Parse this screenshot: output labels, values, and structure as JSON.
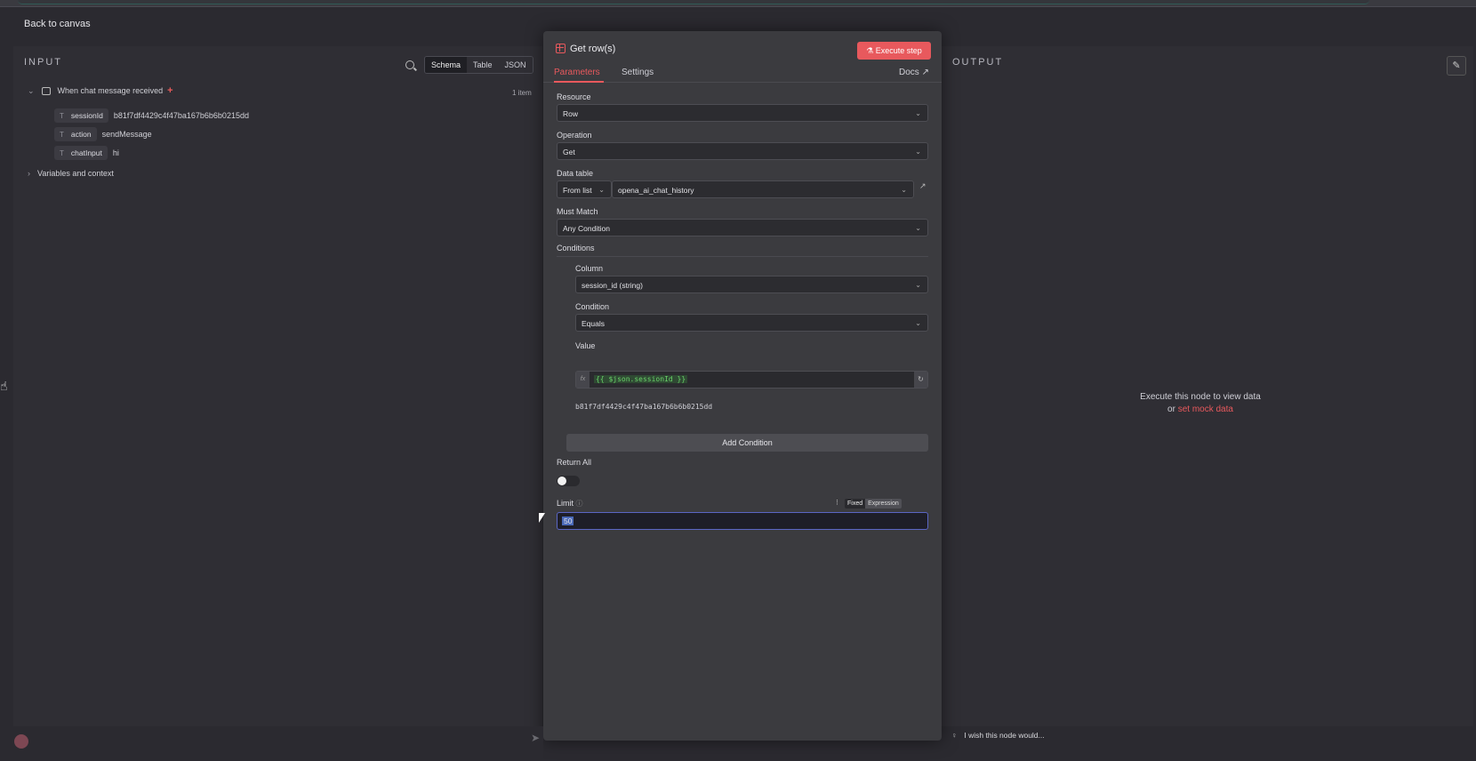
{
  "nav": {
    "back_label": "Back to canvas"
  },
  "input": {
    "title": "INPUT",
    "tabs": [
      "Schema",
      "Table",
      "JSON"
    ],
    "active_tab": "Schema",
    "item_count": "1 item",
    "trigger": "When chat message received",
    "fields": [
      {
        "type": "T",
        "key": "sessionId",
        "value": "b81f7df4429c4f47ba167b6b6b0215dd"
      },
      {
        "type": "T",
        "key": "action",
        "value": "sendMessage"
      },
      {
        "type": "T",
        "key": "chatInput",
        "value": "hi"
      }
    ],
    "variables_label": "Variables and context"
  },
  "node": {
    "title": "Get row(s)",
    "execute_label": "Execute step",
    "tabs": [
      "Parameters",
      "Settings"
    ],
    "docs_label": "Docs",
    "resource": {
      "label": "Resource",
      "value": "Row"
    },
    "operation": {
      "label": "Operation",
      "value": "Get"
    },
    "data_table": {
      "label": "Data table",
      "mode": "From list",
      "value": "opena_ai_chat_history"
    },
    "must_match": {
      "label": "Must Match",
      "value": "Any Condition"
    },
    "conditions_label": "Conditions",
    "column": {
      "label": "Column",
      "value": "session_id (string)"
    },
    "condition": {
      "label": "Condition",
      "value": "Equals"
    },
    "value": {
      "label": "Value",
      "fx": "fx",
      "expression": "{{ $json.sessionId }}",
      "result": "b81f7df4429c4f47ba167b6b6b0215dd"
    },
    "add_condition_label": "Add Condition",
    "return_all": {
      "label": "Return All",
      "value": false
    },
    "limit": {
      "label": "Limit",
      "value": "50",
      "modes": [
        "Fixed",
        "Expression"
      ],
      "active_mode": "Fixed"
    }
  },
  "output": {
    "title": "OUTPUT",
    "empty_msg": "Execute this node to view data",
    "or_label": "or",
    "mock_link": "set mock data"
  },
  "footer": {
    "chat_placeholder": "",
    "wish_label": "I wish this node would..."
  },
  "colors": {
    "accent": "#e8595d",
    "bg": "#2b2a30",
    "modal": "#3b3b3f"
  }
}
